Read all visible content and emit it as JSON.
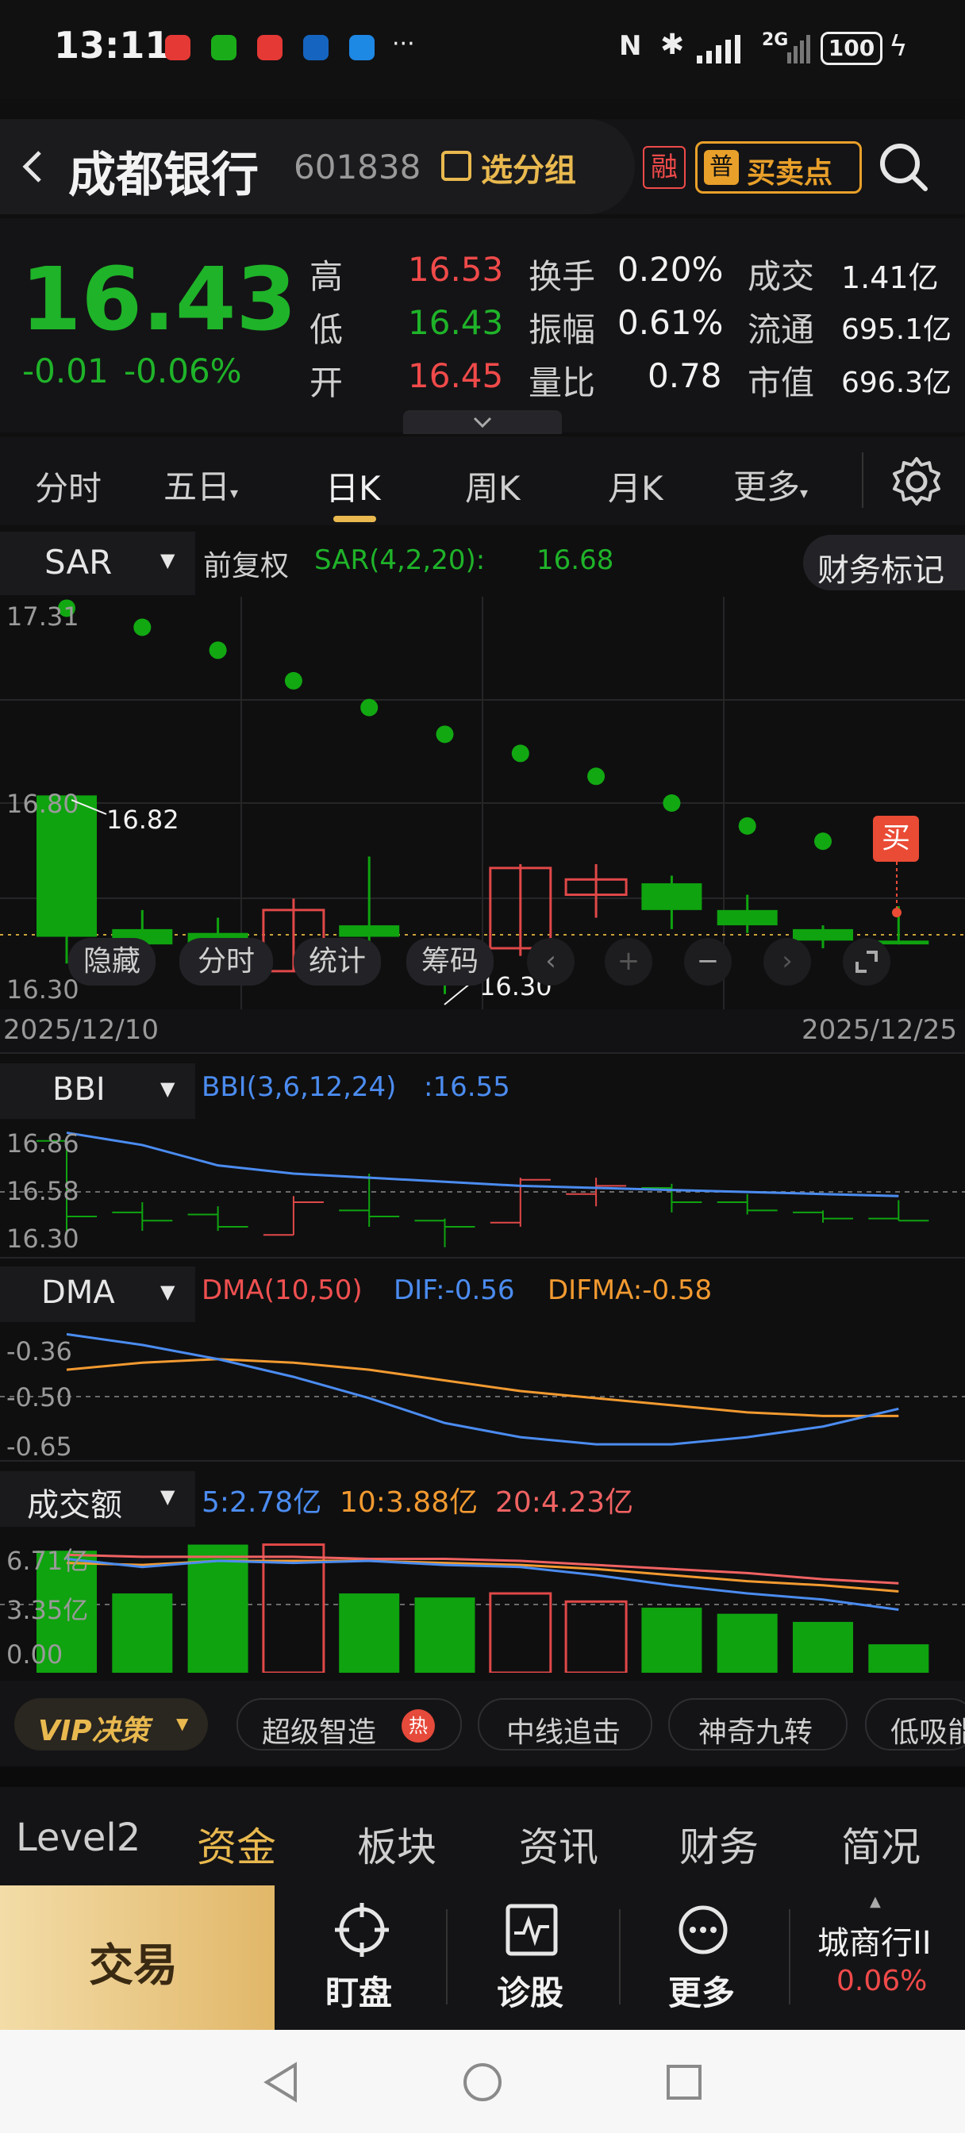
{
  "status_bar": {
    "time": "13:11",
    "battery": "100",
    "net": "2G"
  },
  "stock": {
    "name": "成都银行",
    "code": "601838",
    "group_label": "选分组",
    "margin_badge": "融",
    "buy_sell_label": "买卖点"
  },
  "quote": {
    "price": "16.43",
    "change": "-0.01",
    "change_pct": "-0.06%",
    "high_label": "高",
    "high": "16.53",
    "low_label": "低",
    "low": "16.43",
    "open_label": "开",
    "open": "16.45",
    "turnover_label": "换手",
    "turnover": "0.20%",
    "amplitude_label": "振幅",
    "amplitude": "0.61%",
    "vol_ratio_label": "量比",
    "vol_ratio": "0.78",
    "amount_label": "成交",
    "amount": "1.41亿",
    "float_label": "流通",
    "float": "695.1亿",
    "mcap_label": "市值",
    "mcap": "696.3亿"
  },
  "period_tabs": [
    "分时",
    "五日",
    "日K",
    "周K",
    "月K",
    "更多"
  ],
  "active_tab": "日K",
  "main_chart": {
    "indicator": "SAR",
    "adjust": "前复权",
    "formula": "SAR(4,2,20):",
    "value": "16.68",
    "fin_mark": "财务标记",
    "y_top": "17.31",
    "y_mid": "16.80",
    "y_bot": "16.30",
    "high_marker": "16.82",
    "low_marker": "16.30",
    "date_start": "2025/12/10",
    "date_end": "2025/12/25",
    "buy_tag": "买",
    "overlay_buttons": [
      "隐藏",
      "分时",
      "统计",
      "筹码"
    ]
  },
  "bbi": {
    "name": "BBI",
    "formula": "BBI(3,6,12,24)",
    "value": ":16.55",
    "y": [
      "16.86",
      "16.58",
      "16.30"
    ]
  },
  "dma": {
    "name": "DMA",
    "formula": "DMA(10,50)",
    "dif": "DIF:-0.56",
    "difma": "DIFMA:-0.58",
    "y": [
      "-0.36",
      "-0.50",
      "-0.65"
    ]
  },
  "amount": {
    "name": "成交额",
    "ma5": "5:2.78亿",
    "ma10": "10:3.88亿",
    "ma20": "20:4.23亿",
    "y": [
      "6.71亿",
      "3.35亿",
      "0.00"
    ]
  },
  "strategy_bar": {
    "vip": "VIP决策",
    "items": [
      "超级智造",
      "中线追击",
      "神奇九转",
      "低吸能"
    ],
    "hot": "热"
  },
  "section_tabs": [
    "Level2",
    "资金",
    "板块",
    "资讯",
    "财务",
    "简况"
  ],
  "active_section": "资金",
  "bottom_bar": {
    "trade": "交易",
    "watch": "盯盘",
    "diagnose": "诊股",
    "more": "更多",
    "sector": "城商行II",
    "sector_pct": "0.06%"
  },
  "chart_data": {
    "type": "candlestick",
    "x_range": [
      "2025/12/10",
      "2025/12/25"
    ],
    "candles": [
      {
        "open": 16.82,
        "close": 16.45,
        "high": 16.82,
        "low": 16.38,
        "color": "green"
      },
      {
        "open": 16.47,
        "close": 16.43,
        "high": 16.52,
        "low": 16.38,
        "color": "green"
      },
      {
        "open": 16.46,
        "close": 16.4,
        "high": 16.5,
        "low": 16.38,
        "color": "green"
      },
      {
        "open": 16.36,
        "close": 16.52,
        "high": 16.55,
        "low": 16.36,
        "color": "red"
      },
      {
        "open": 16.48,
        "close": 16.45,
        "high": 16.66,
        "low": 16.4,
        "color": "green"
      },
      {
        "open": 16.43,
        "close": 16.4,
        "high": 16.44,
        "low": 16.3,
        "color": "green"
      },
      {
        "open": 16.42,
        "close": 16.63,
        "high": 16.64,
        "low": 16.4,
        "color": "red"
      },
      {
        "open": 16.56,
        "close": 16.6,
        "high": 16.64,
        "low": 16.5,
        "color": "red"
      },
      {
        "open": 16.59,
        "close": 16.52,
        "high": 16.61,
        "low": 16.47,
        "color": "green"
      },
      {
        "open": 16.52,
        "close": 16.48,
        "high": 16.56,
        "low": 16.46,
        "color": "green"
      },
      {
        "open": 16.47,
        "close": 16.44,
        "high": 16.48,
        "low": 16.42,
        "color": "green"
      },
      {
        "open": 16.44,
        "close": 16.43,
        "high": 16.53,
        "low": 16.43,
        "color": "green"
      }
    ],
    "sar": [
      17.31,
      17.26,
      17.2,
      17.12,
      17.05,
      16.98,
      16.93,
      16.87,
      16.8,
      16.74,
      16.7,
      16.68
    ],
    "bbi_line": [
      16.86,
      16.8,
      16.7,
      16.66,
      16.64,
      16.62,
      16.6,
      16.59,
      16.58,
      16.57,
      16.56,
      16.55
    ],
    "dma_dif": [
      -0.35,
      -0.38,
      -0.42,
      -0.47,
      -0.53,
      -0.6,
      -0.64,
      -0.66,
      -0.66,
      -0.64,
      -0.61,
      -0.56
    ],
    "dma_difma": [
      -0.45,
      -0.43,
      -0.42,
      -0.43,
      -0.45,
      -0.48,
      -0.51,
      -0.53,
      -0.55,
      -0.57,
      -0.58,
      -0.58
    ],
    "amount_bars": [
      6.0,
      3.9,
      6.3,
      6.3,
      3.9,
      3.7,
      3.9,
      3.5,
      3.2,
      2.9,
      2.5,
      1.4
    ],
    "amount_ylim": [
      0,
      6.71
    ]
  }
}
